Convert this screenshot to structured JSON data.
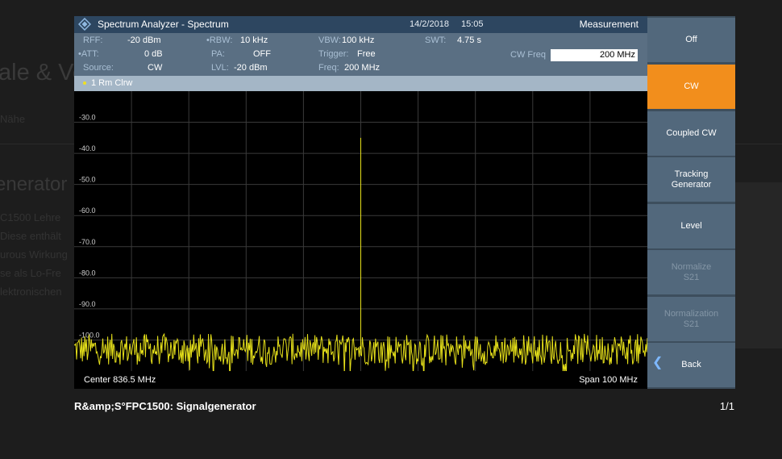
{
  "background_page": {
    "heading": "ale & Ve",
    "subheading": "enerator",
    "lines": [
      "Nähe",
      "C1500 Lehre",
      "Diese enthält",
      "urous Wirkung",
      "se als Lo-Fre",
      "lektronischen"
    ]
  },
  "analyzer": {
    "app_title": "Spectrum Analyzer - Spectrum",
    "date": "14/2/2018",
    "time": "15:05",
    "settings": {
      "rff_label": "RFF:",
      "rff_value": "-20 dBm",
      "att_label": "ATT:",
      "att_value": "0 dB",
      "source_label": "Source:",
      "source_value": "CW",
      "rbw_label": "RBW:",
      "rbw_value": "10 kHz",
      "pa_label": "PA:",
      "pa_value": "OFF",
      "lvl_label": "LVL:",
      "lvl_value": "-20 dBm",
      "vbw_label": "VBW:",
      "vbw_value": "100 kHz",
      "trigger_label": "Trigger:",
      "trigger_value": "Free",
      "freq_label": "Freq:",
      "freq_value": "200 MHz",
      "swt_label": "SWT:",
      "swt_value": "4.75 s"
    },
    "measurement": {
      "title": "Measurement",
      "cw_freq_label": "CW Freq",
      "cw_freq_value": "200 MHz"
    },
    "trace_label": "1 Rm  Clrw",
    "y_ticks": [
      "-30.0",
      "-40.0",
      "-50.0",
      "-60.0",
      "-70.0",
      "-80.0",
      "-90.0",
      "-100.0"
    ],
    "center_label": "Center",
    "center_value": "836.5 MHz",
    "span_label": "Span",
    "span_value": "100 MHz",
    "softkeys": [
      {
        "label": "Off",
        "state": "normal"
      },
      {
        "label": "CW",
        "state": "active"
      },
      {
        "label": "Coupled CW",
        "state": "normal"
      },
      {
        "label": "Tracking Generator",
        "state": "normal"
      },
      {
        "label": "Level",
        "state": "normal"
      },
      {
        "label": "Normalize S21",
        "state": "disabled"
      },
      {
        "label": "Normalization S21",
        "state": "disabled"
      },
      {
        "label": "Back",
        "state": "normal"
      }
    ]
  },
  "chart_data": {
    "type": "line",
    "ylim": [
      -110,
      -20
    ],
    "y_tick_values": [
      -30,
      -40,
      -50,
      -60,
      -70,
      -80,
      -90,
      -100
    ],
    "noise_floor_db": -103,
    "noise_spread_db": 5,
    "peak": {
      "x_fraction": 0.5,
      "value_db": -35
    },
    "trace_color": "#e6e01a",
    "grid": true
  },
  "caption": "R&amp;S°FPC1500: Signalgenerator",
  "counter": "1/1",
  "colors": {
    "accent": "#f28e1c",
    "header": "#2d4660",
    "settings": "#5a6f83",
    "trace": "#e6e01a"
  }
}
